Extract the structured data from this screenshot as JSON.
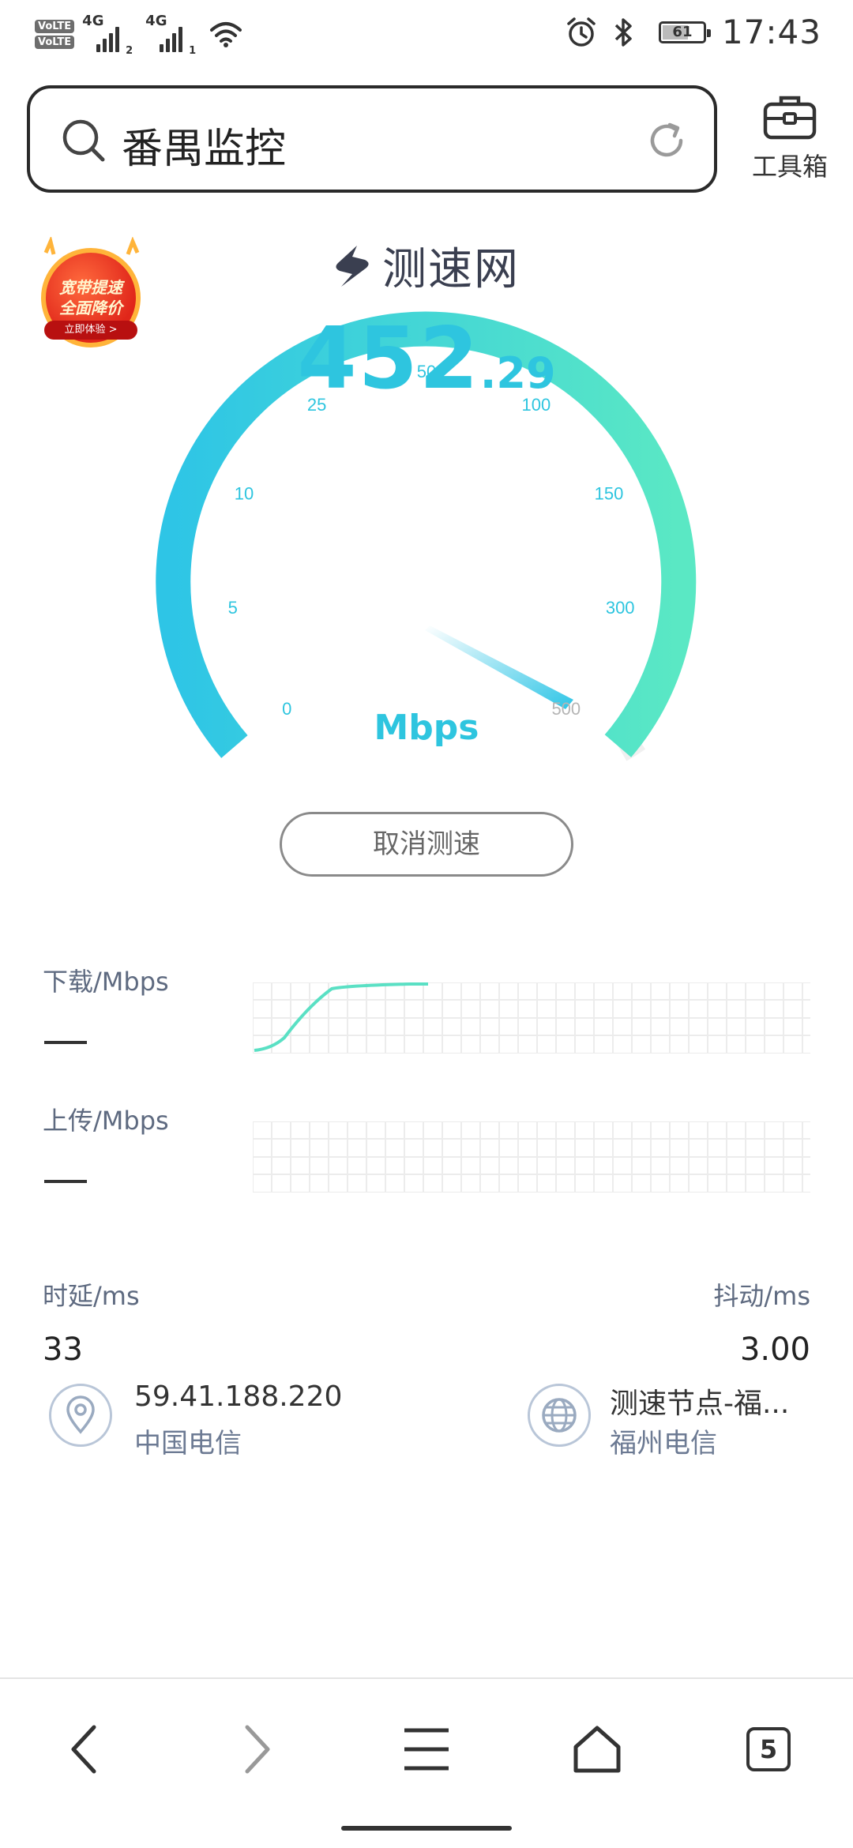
{
  "status_bar": {
    "volte_1": "VoLTE",
    "volte_2": "VoLTE",
    "network_1": "4G",
    "sim_1": "2",
    "network_2": "4G",
    "sim_2": "1",
    "battery": "61",
    "battery_level": 0.61,
    "time": "17:43"
  },
  "search": {
    "query": "番禺监控",
    "icon": "search-icon",
    "reload_icon": "reload-icon"
  },
  "toolbox": {
    "label": "工具箱",
    "icon": "toolbox-icon"
  },
  "promo": {
    "line1": "宽带提速",
    "line2": "全面降价",
    "button": "立即体验 >"
  },
  "brand": {
    "name": "测速网",
    "icon": "speedtest-logo-icon"
  },
  "gauge": {
    "ticks": [
      "0",
      "5",
      "10",
      "25",
      "50",
      "100",
      "150",
      "300",
      "500"
    ],
    "speed_int": "452",
    "speed_dec": ".29",
    "unit": "Mbps",
    "colors": {
      "start": "#2ec5e6",
      "end": "#5ae8c4",
      "track": "#f0f0f0"
    }
  },
  "cancel_button": "取消测速",
  "download": {
    "label": "下载/Mbps",
    "value": "—"
  },
  "upload": {
    "label": "上传/Mbps",
    "value": "—"
  },
  "latency": {
    "label": "时延/ms",
    "value": "33"
  },
  "jitter": {
    "label": "抖动/ms",
    "value": "3.00"
  },
  "client": {
    "ip": "59.41.188.220",
    "isp": "中国电信",
    "icon": "location-pin-icon"
  },
  "server": {
    "name": "测速节点-福...",
    "isp": "福州电信",
    "icon": "globe-icon"
  },
  "nav": {
    "tab_count": "5",
    "icons": [
      "back-icon",
      "forward-icon",
      "menu-icon",
      "home-icon",
      "tabs-icon"
    ]
  }
}
